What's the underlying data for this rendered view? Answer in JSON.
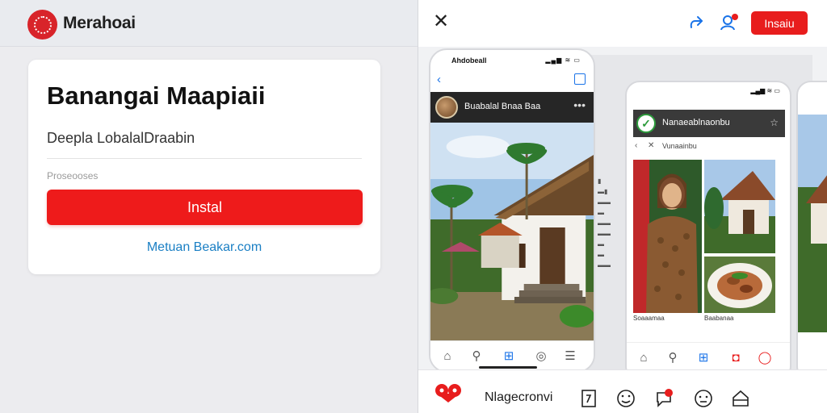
{
  "left": {
    "brand_name": "Merahoai",
    "card": {
      "title": "Banangai Maapiaii",
      "subtitle": "Deepla LobalalDraabin",
      "meta": "Proseooses",
      "install_label": "Instal",
      "website_link": "Metuan Beakar.com"
    }
  },
  "right": {
    "header": {
      "button_label": "Insaiu"
    },
    "phone1": {
      "time": "Ahdobeall",
      "post_title": "Buabalal Bnaa Baa",
      "signals": "▂▄▆ ≋ ▭"
    },
    "phone2": {
      "signals": "▂▄▆ ≋ ▭",
      "header_title": "Nanaeablnaonbu",
      "subtext": "Vunaainbu",
      "caption_left": "Soaaamaa",
      "caption_right": "Baabanaa"
    },
    "bottom_bar": {
      "label": "Nlagecronvi"
    }
  },
  "colors": {
    "accent_red": "#e81d1d",
    "link_blue": "#1a7fc4",
    "icon_blue": "#1a73e8"
  }
}
